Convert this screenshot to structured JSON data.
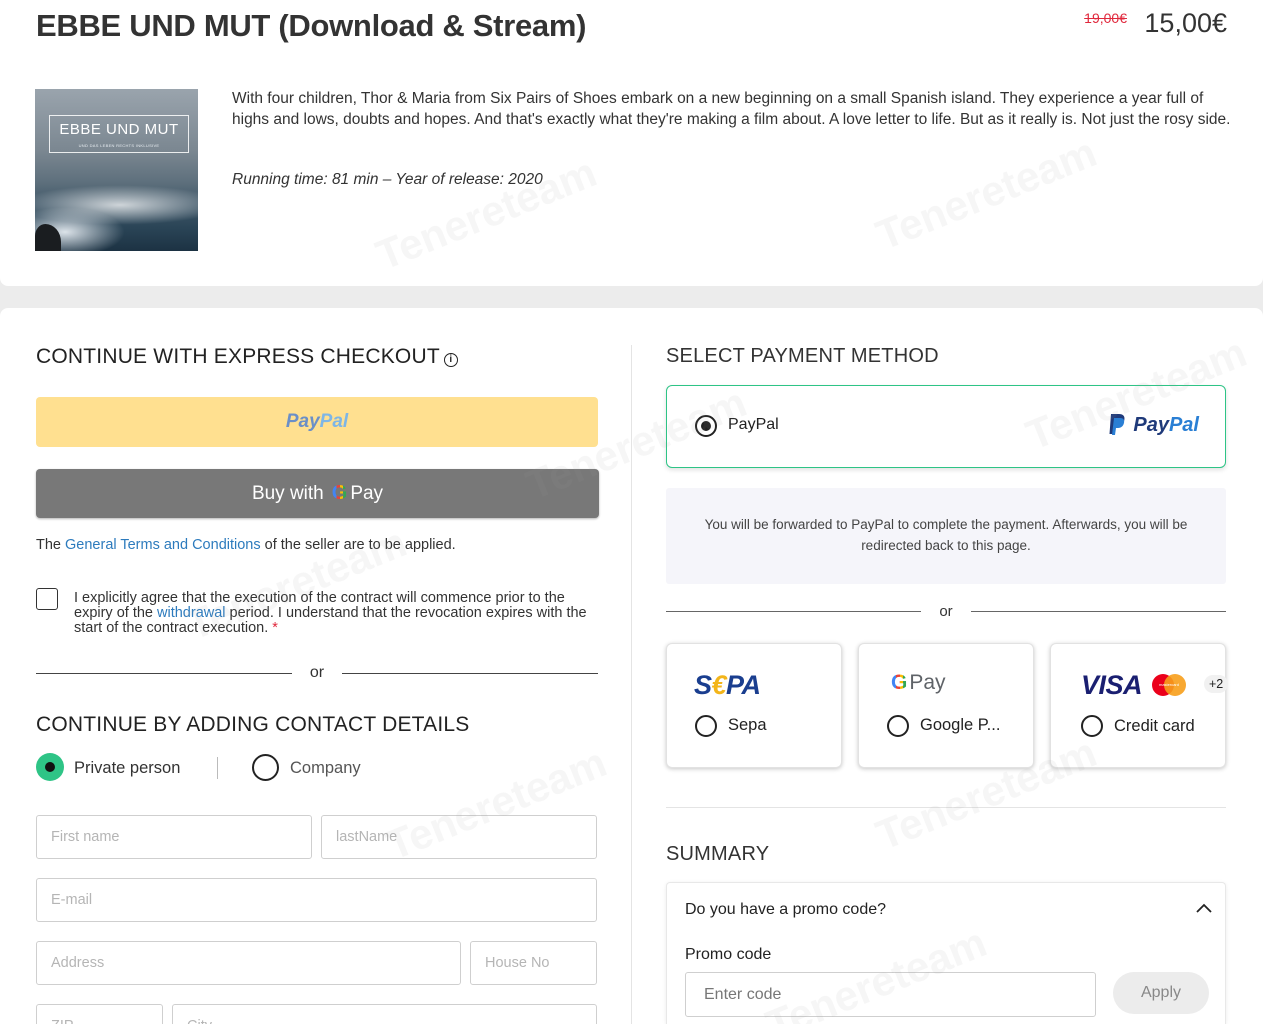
{
  "product": {
    "title": "EBBE UND MUT (Download & Stream)",
    "old_price": "19,00€",
    "price": "15,00€",
    "poster_title": "EBBE UND MUT",
    "poster_subtitle": "UND DAS LEBEN RECHTS INKLUSIVE",
    "description": "With four children, Thor & Maria from Six Pairs of Shoes embark on a new beginning on a small Spanish island. They experience a year full of highs and lows, doubts and hopes. And that's exactly what they're making a film about. A love letter to life. But as it really is. Not just the rosy side.",
    "meta": "Running time: 81 min –  Year of release: 2020"
  },
  "express": {
    "heading": "CONTINUE WITH EXPRESS CHECKOUT",
    "info_icon": "info-icon",
    "paypal_pay": "Pay",
    "paypal_pal": "Pal",
    "gpay_prefix": "Buy with",
    "gpay_g": "G",
    "gpay_pay": "Pay",
    "terms_prefix": "The ",
    "terms_link": "General Terms and Conditions",
    "terms_suffix": " of the seller are to be applied.",
    "agree_part1": "I explicitly agree that the execution of the contract will commence prior to the expiry of the ",
    "agree_link": "withdrawal",
    "agree_part2": " period. I understand that the revocation expires with the start of the contract execution.",
    "agree_required": "*",
    "or": "or"
  },
  "contact": {
    "heading": "CONTINUE BY ADDING CONTACT DETAILS",
    "private_label": "Private person",
    "company_label": "Company",
    "first_name_ph": "First name",
    "last_name_ph": "lastName",
    "email_ph": "E-mail",
    "address_ph": "Address",
    "house_ph": "House No",
    "zip_ph": "ZIP",
    "city_ph": "City"
  },
  "payment": {
    "heading": "SELECT PAYMENT METHOD",
    "selected_label": "PayPal",
    "logo_pay": "Pay",
    "logo_pal": "Pal",
    "info": "You will be forwarded to PayPal to complete the payment. Afterwards, you will be redirected back to this page.",
    "or": "or",
    "sepa_s": "S",
    "sepa_e": "€",
    "sepa_pa": "PA",
    "sepa_label": "Sepa",
    "gpay_g": "G",
    "gpay_pay": "Pay",
    "gpay_label": "Google P...",
    "visa": "VISA",
    "mc_text": "mastercard",
    "more": "+2",
    "card_label": "Credit card"
  },
  "summary": {
    "heading": "SUMMARY",
    "promo_question": "Do you have a promo code?",
    "promo_label": "Promo code",
    "promo_ph": "Enter code",
    "apply": "Apply"
  },
  "watermark": "Tenereteam"
}
